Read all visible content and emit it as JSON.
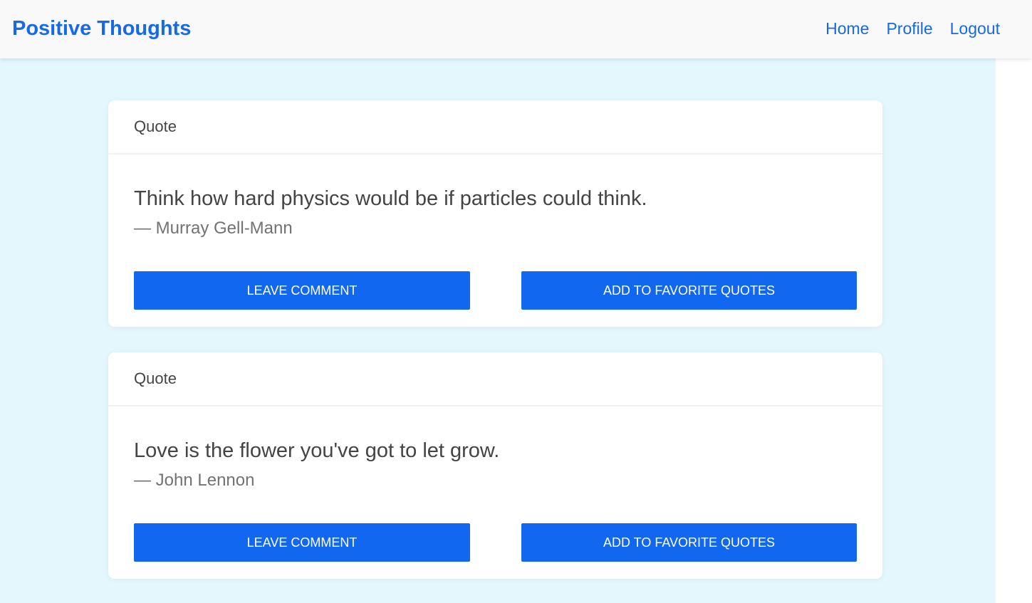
{
  "navbar": {
    "brand": "Positive Thoughts",
    "links": [
      {
        "label": "Home"
      },
      {
        "label": "Profile"
      },
      {
        "label": "Logout"
      }
    ]
  },
  "quotes": [
    {
      "header": "Quote",
      "text": "Think how hard physics would be if particles could think.",
      "author": "— Murray Gell-Mann",
      "comment_label": "LEAVE COMMENT",
      "favorite_label": "ADD TO FAVORITE QUOTES"
    },
    {
      "header": "Quote",
      "text": "Love is the flower you've got to let grow.",
      "author": "— John Lennon",
      "comment_label": "LEAVE COMMENT",
      "favorite_label": "ADD TO FAVORITE QUOTES"
    }
  ],
  "colors": {
    "accent": "#1769e6",
    "button": "#1267f0",
    "background": "#e3f7fd"
  }
}
